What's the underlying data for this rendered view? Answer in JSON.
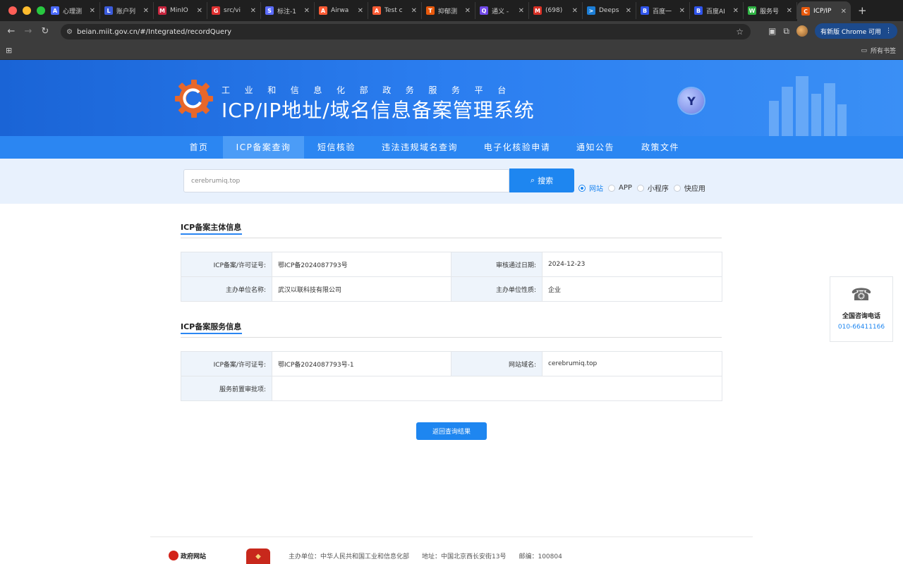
{
  "browser": {
    "tabs": [
      {
        "label": "心理测",
        "icon": "A",
        "color": "#4b6bff"
      },
      {
        "label": "账户列",
        "icon": "L",
        "color": "#3b5bdb"
      },
      {
        "label": "MinIO",
        "icon": "M",
        "color": "#c7253e"
      },
      {
        "label": "src/vi",
        "icon": "G",
        "color": "#e03131"
      },
      {
        "label": "标注-1",
        "icon": "S",
        "color": "#5b6cff"
      },
      {
        "label": "Airwa",
        "icon": "A",
        "color": "#ff5c35"
      },
      {
        "label": "Test c",
        "icon": "A",
        "color": "#ff5c35"
      },
      {
        "label": "抑郁测",
        "icon": "T",
        "color": "#e8590c"
      },
      {
        "label": "通义 -",
        "icon": "Q",
        "color": "#7048e8"
      },
      {
        "label": "(698)",
        "icon": "M",
        "color": "#d93025"
      },
      {
        "label": "Deeps",
        "icon": ">",
        "color": "#1c7ed6"
      },
      {
        "label": "百度一",
        "icon": "B",
        "color": "#2f54eb"
      },
      {
        "label": "百度AI",
        "icon": "B",
        "color": "#2f54eb"
      },
      {
        "label": "服务号",
        "icon": "W",
        "color": "#2fb344"
      },
      {
        "label": "ICP/IP",
        "icon": "C",
        "color": "#e8590c",
        "active": true
      }
    ],
    "tab_close": "✕",
    "new_tab": "+",
    "url": "beian.miit.gov.cn/#/Integrated/recordQuery",
    "update_label": "有新版 Chrome 可用",
    "all_bookmarks": "所有书签"
  },
  "header": {
    "subtitle": "工业和信息化部政务服务平台",
    "title": "ICP/IP地址/域名信息备案管理系统"
  },
  "nav": [
    {
      "label": "首页",
      "active": false
    },
    {
      "label": "ICP备案查询",
      "active": true
    },
    {
      "label": "短信核验",
      "active": false
    },
    {
      "label": "违法违规域名查询",
      "active": false
    },
    {
      "label": "电子化核验申请",
      "active": false
    },
    {
      "label": "通知公告",
      "active": false
    },
    {
      "label": "政策文件",
      "active": false
    }
  ],
  "search": {
    "value": "cerebrumiq.top",
    "button_label": "搜索",
    "types": [
      {
        "label": "网站",
        "checked": true
      },
      {
        "label": "APP",
        "checked": false
      },
      {
        "label": "小程序",
        "checked": false
      },
      {
        "label": "快应用",
        "checked": false
      }
    ]
  },
  "subject_info": {
    "title": "ICP备案主体信息",
    "rows": [
      {
        "k1": "ICP备案/许可证号:",
        "v1": "鄂ICP备2024087793号",
        "k2": "审核通过日期:",
        "v2": "2024-12-23"
      },
      {
        "k1": "主办单位名称:",
        "v1": "武汉以联科技有限公司",
        "k2": "主办单位性质:",
        "v2": "企业"
      }
    ]
  },
  "service_info": {
    "title": "ICP备案服务信息",
    "license_label": "ICP备案/许可证号:",
    "license_value": "鄂ICP备2024087793号-1",
    "domain_label": "网站域名:",
    "domain_value": "cerebrumiq.top",
    "preapproval_label": "服务前置审批项:",
    "preapproval_value": ""
  },
  "back_button": "返回查询结果",
  "hotline": {
    "title": "全国咨询电话",
    "number": "010-66411166"
  },
  "footer": {
    "gov_site": "政府网站",
    "sponsor": "主办单位：中华人民共和国工业和信息化部",
    "address": "地址：中国北京西长安街13号",
    "postcode": "邮编：100804"
  },
  "colors": {
    "primary": "#1e86f0",
    "header_blue": "#2b7ef0",
    "nav_blue": "#2b86f2"
  }
}
